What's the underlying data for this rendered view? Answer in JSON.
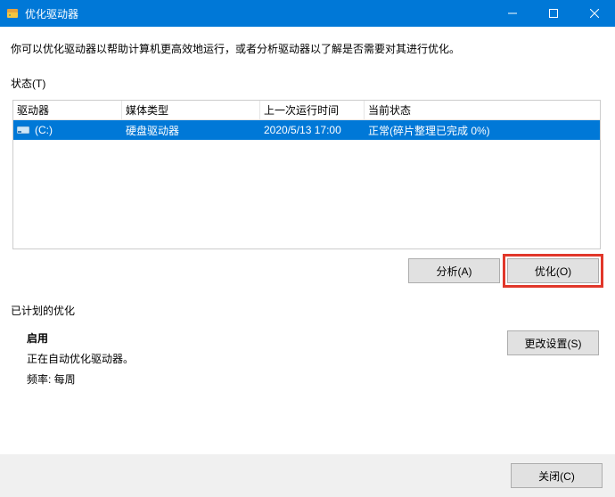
{
  "titlebar": {
    "title": "优化驱动器"
  },
  "description": "你可以优化驱动器以帮助计算机更高效地运行，或者分析驱动器以了解是否需要对其进行优化。",
  "status_label": "状态(T)",
  "columns": {
    "drive": "驱动器",
    "media": "媒体类型",
    "lastrun": "上一次运行时间",
    "status": "当前状态"
  },
  "drives": [
    {
      "name": "(C:)",
      "media": "硬盘驱动器",
      "lastrun": "2020/5/13 17:00",
      "status": "正常(碎片整理已完成 0%)"
    }
  ],
  "buttons": {
    "analyze": "分析(A)",
    "optimize": "优化(O)",
    "change_settings": "更改设置(S)",
    "close": "关闭(C)"
  },
  "scheduled": {
    "title": "已计划的优化",
    "enabled": "启用",
    "desc": "正在自动优化驱动器。",
    "frequency": "频率: 每周"
  }
}
